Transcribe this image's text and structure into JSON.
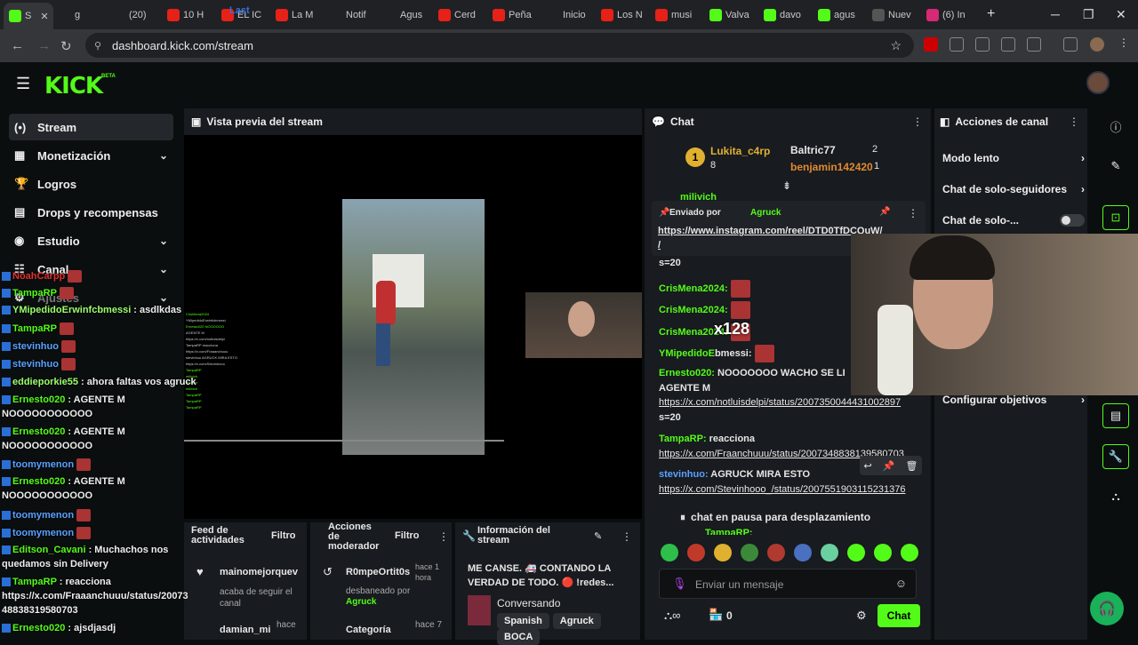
{
  "browser": {
    "tabs": [
      {
        "label": "S",
        "color": "#53fc18",
        "icon": "kick-icon"
      },
      {
        "label": "g",
        "color": "#202124",
        "icon": "x-icon"
      },
      {
        "label": "(20)",
        "color": "#202124",
        "icon": "tiktok-icon"
      },
      {
        "label": "10 H",
        "color": "#e62117",
        "icon": "youtube-icon"
      },
      {
        "label": "EL IC",
        "color": "#e62117",
        "icon": "youtube-icon"
      },
      {
        "label": "La M",
        "color": "#e62117",
        "icon": "youtube-icon"
      },
      {
        "label": "Notif",
        "color": "#202124",
        "icon": "x-icon"
      },
      {
        "label": "Agus",
        "color": "#202124",
        "icon": "tiktok-icon"
      },
      {
        "label": "Cerd",
        "color": "#e62117",
        "icon": "youtube-icon"
      },
      {
        "label": "Peña",
        "color": "#e62117",
        "icon": "youtube-icon"
      },
      {
        "label": "Inicio",
        "color": "#202124",
        "icon": "x-icon"
      },
      {
        "label": "Los N",
        "color": "#e62117",
        "icon": "youtube-icon"
      },
      {
        "label": "musi",
        "color": "#e62117",
        "icon": "youtube-icon"
      },
      {
        "label": "Valva",
        "color": "#53fc18",
        "icon": "kick-icon"
      },
      {
        "label": "davo",
        "color": "#53fc18",
        "icon": "kick-icon"
      },
      {
        "label": "agus",
        "color": "#53fc18",
        "icon": "kick-icon"
      },
      {
        "label": "Nuev",
        "color": "#555",
        "icon": "globe-icon"
      },
      {
        "label": "(6) In",
        "color": "#d62976",
        "icon": "instagram-icon"
      }
    ],
    "tab_overlay_text": "Last",
    "url": "dashboard.kick.com/stream"
  },
  "brand": {
    "logo": "KICK",
    "beta": "BETA"
  },
  "sidebar": {
    "items": [
      {
        "label": "Stream",
        "icon": "(•)"
      },
      {
        "label": "Monetización",
        "icon": "▦"
      },
      {
        "label": "Logros",
        "icon": "🏆"
      },
      {
        "label": "Drops y recompensas",
        "icon": "▤"
      },
      {
        "label": "Estudio",
        "icon": "◉"
      },
      {
        "label": "Canal",
        "icon": "☷"
      },
      {
        "label": "Ajustes",
        "icon": "⚙"
      }
    ]
  },
  "overlay_chat": [
    {
      "user": "NoahCarpp",
      "text": ""
    },
    {
      "user": "TampaRP",
      "text": ""
    },
    {
      "user": "YMipedidoErwinfcbmessi",
      "text": " : asdlkdas"
    },
    {
      "user": "TampaRP",
      "text": ""
    },
    {
      "user": "stevinhuo",
      "text": ""
    },
    {
      "user": "stevinhuo",
      "text": ""
    },
    {
      "user": "eddieporkie55",
      "text": " : ahora faltas vos agruck"
    },
    {
      "user": "Ernesto020",
      "text": " : AGENTE M"
    },
    {
      "user": "",
      "text": "NOOOOOOOOOOO"
    },
    {
      "user": "Ernesto020",
      "text": " : AGENTE M"
    },
    {
      "user": "",
      "text": "NOOOOOOOOOOO"
    },
    {
      "user": "toomymenon",
      "text": ""
    },
    {
      "user": "Ernesto020",
      "text": " : AGENTE M"
    },
    {
      "user": "",
      "text": "NOOOOOOOOOOO"
    },
    {
      "user": "toomymenon",
      "text": ""
    },
    {
      "user": "toomymenon",
      "text": ""
    },
    {
      "user": "Editson_Cavani",
      "text": " : Muchachos nos"
    },
    {
      "user": "",
      "text": "quedamos sin Delivery"
    },
    {
      "user": "TampaRP",
      "text": " : reacciona"
    },
    {
      "user": "",
      "text": "https://x.com/Fraaanchuuu/status/20073"
    },
    {
      "user": "",
      "text": "48838319580703"
    },
    {
      "user": "Ernesto020",
      "text": " : ajsdjasdj"
    }
  ],
  "preview": {
    "title": "Vista previa del stream"
  },
  "bottom_panels": {
    "activity": {
      "title": "Feed de actividades",
      "filter": "Filtro",
      "item1_user": "mainomejorquev",
      "item1_desc": "acaba de seguir el canal",
      "item2_user": "damian_mi",
      "item2_time": "hace"
    },
    "mod": {
      "title": "Acciones de moderador",
      "filter": "Filtro",
      "item1_user": "R0mpeOrtit0s",
      "item1_time": "hace 1 hora",
      "item1_desc": "desbaneado por",
      "item1_by": "Agruck",
      "item2_user": "Categoría",
      "item2_time": "hace 7"
    },
    "info": {
      "title": "Información del stream",
      "stream_title": "ME CANSE. 🚑 CONTANDO LA VERDAD DE TODO. 🔴 !redes...",
      "category": "Conversando",
      "tags": [
        "Spanish",
        "Agruck",
        "BOCA"
      ]
    }
  },
  "chat": {
    "title": "Chat",
    "leaders": [
      {
        "rank": "1",
        "user": "Lukita_c4rp",
        "count": "8"
      },
      {
        "rank": "",
        "user": "Baltric77",
        "count": "2"
      },
      {
        "rank": "",
        "user": "benjamin142420",
        "count": "1"
      }
    ],
    "partial_top": "milivich",
    "pinned": {
      "label": "Enviado por",
      "user": "Agruck",
      "link": "https://www.instagram.com/reel/DTD0TfDCQuW/",
      "suffix": "/"
    },
    "messages": [
      {
        "user": "",
        "text": "s=20"
      },
      {
        "user": "CrisMena2024:",
        "text": ""
      },
      {
        "user": "CrisMena2024:",
        "text": ""
      },
      {
        "user": "CrisMena2024:",
        "text": ""
      },
      {
        "user": "YMipedidoE",
        "text": "bmessi:"
      },
      {
        "user": "Ernesto020:",
        "text": " NOOOOOOO WACHO SE LI"
      },
      {
        "user": "",
        "text": "AGENTE M"
      },
      {
        "user": "",
        "text": "https://x.com/notluisdelpi/status/2007350044431002897"
      },
      {
        "user": "",
        "text": "s=20"
      },
      {
        "user": "TampaRP:",
        "text": " reacciona"
      },
      {
        "user": "",
        "text": "https://x.com/Fraanchuuu/status/2007348838139580703"
      },
      {
        "user": "stevinhuo:",
        "text": " AGRUCK MIRA ESTO"
      },
      {
        "user": "",
        "text": "https://x.com/Stevinhooo_/status/2007551903115231376"
      }
    ],
    "emote_label": "x128",
    "paused": "chat en pausa para desplazamiento",
    "partial_bottom": "TampaRP:",
    "placeholder": "Enviar un mensaje",
    "count": "0",
    "send": "Chat"
  },
  "channel_actions": {
    "title": "Acciones de canal",
    "items": [
      {
        "label": "Modo lento"
      },
      {
        "label": "Chat de solo-seguidores"
      },
      {
        "label": "Chat de solo-..."
      },
      {
        "label": "Configurar objetivos"
      }
    ]
  },
  "colors": {
    "accent": "#53fc18",
    "bg": "#0b0e0f",
    "panel": "#181b1f"
  }
}
